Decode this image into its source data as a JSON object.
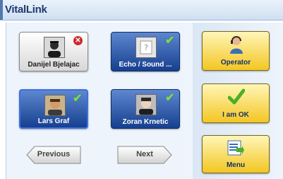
{
  "app": {
    "title": "VitalLink"
  },
  "contacts": [
    {
      "name": "Danijel Bjelajac",
      "status": "unavailable",
      "status_icon": "x-icon"
    },
    {
      "name": "Echo / Sound ...",
      "status": "available",
      "status_icon": "checkmark-icon"
    },
    {
      "name": "Lars Graf",
      "status": "available",
      "status_icon": "checkmark-icon"
    },
    {
      "name": "Zoran Krnetic",
      "status": "available",
      "status_icon": "checkmark-icon"
    }
  ],
  "navigation": {
    "previous_label": "Previous",
    "next_label": "Next"
  },
  "actions": {
    "operator_label": "Operator",
    "i_am_ok_label": "I am OK",
    "menu_label": "Menu"
  },
  "colors": {
    "title_text": "#1c3b6f",
    "contact_active": "#2b5fb8",
    "action_yellow": "#f3c622",
    "status_ok": "#7ed957",
    "status_bad": "#cc2b2b"
  }
}
